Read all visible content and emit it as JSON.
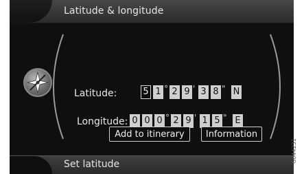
{
  "header": {
    "title": "Latitude & longitude"
  },
  "footer": {
    "label": "Set latitude"
  },
  "compass": {
    "icon": "compass-icon"
  },
  "latitude": {
    "label": "Latitude:",
    "digits": [
      "5",
      "1",
      "2",
      "9",
      "3",
      "8"
    ],
    "degree_sym": "°",
    "minute_sym": "'",
    "second_sym": "\"",
    "direction": "N",
    "active_index": 0
  },
  "longitude": {
    "label": "Longitude:",
    "digits": [
      "0",
      "0",
      "0",
      "2",
      "9",
      "1",
      "5"
    ],
    "degree_sym": "°",
    "minute_sym": "'",
    "second_sym": "\"",
    "direction": "E"
  },
  "buttons": {
    "add_to_itinerary": "Add to itinerary",
    "information": "Information"
  },
  "image_code": "G044231"
}
